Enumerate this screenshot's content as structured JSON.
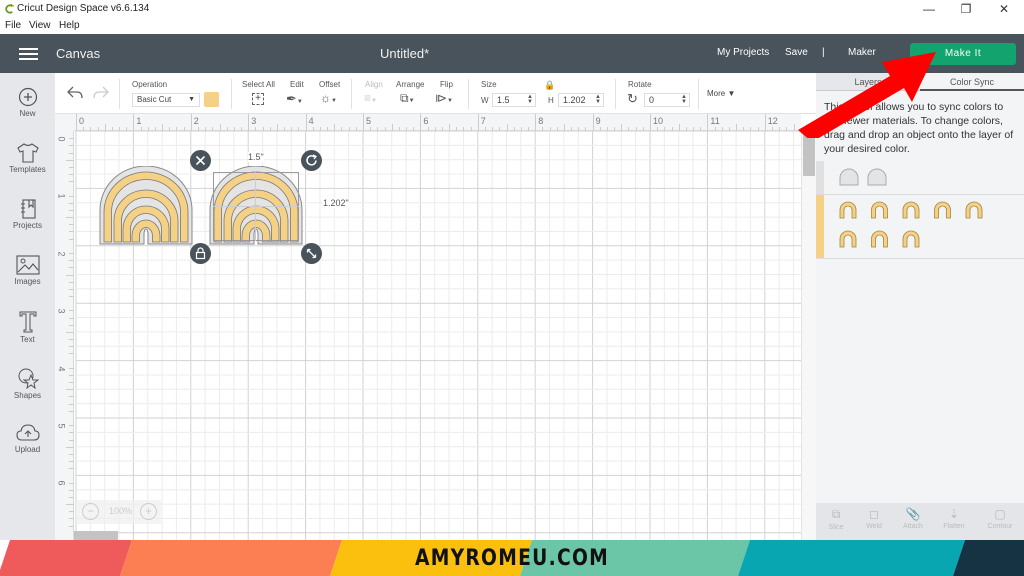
{
  "window": {
    "title": "Cricut Design Space  v6.6.134",
    "controls": [
      "minimize",
      "restore",
      "close"
    ]
  },
  "menubar": {
    "items": [
      "File",
      "View",
      "Help"
    ]
  },
  "header": {
    "section": "Canvas",
    "document_title": "Untitled*",
    "links": {
      "my_projects": "My Projects",
      "save": "Save",
      "separator": "|",
      "machine": "Maker"
    },
    "make_it": "Make It",
    "accent": "#12a36f"
  },
  "toolbar": {
    "operation_label": "Operation",
    "operation_value": "Basic Cut",
    "operation_color": "#f5d185",
    "select_all": "Select All",
    "edit": "Edit",
    "offset": "Offset",
    "align": "Align",
    "arrange": "Arrange",
    "flip": "Flip",
    "size_label": "Size",
    "w_label": "W",
    "w_value": "1.5",
    "h_label": "H",
    "h_value": "1.202",
    "rotate_label": "Rotate",
    "rotate_value": "0",
    "more": "More"
  },
  "sidebar": {
    "items": [
      {
        "label": "New",
        "icon": "plus-circle-icon"
      },
      {
        "label": "Templates",
        "icon": "tshirt-icon"
      },
      {
        "label": "Projects",
        "icon": "notebook-icon"
      },
      {
        "label": "Images",
        "icon": "image-icon"
      },
      {
        "label": "Text",
        "icon": "text-icon"
      },
      {
        "label": "Shapes",
        "icon": "shapes-icon"
      },
      {
        "label": "Upload",
        "icon": "cloud-upload-icon"
      }
    ]
  },
  "canvas": {
    "ruler_top": [
      "0",
      "1",
      "2",
      "3",
      "4",
      "5",
      "6",
      "7",
      "8",
      "9",
      "10",
      "11",
      "12"
    ],
    "ruler_left": [
      "0",
      "1",
      "2",
      "3",
      "4",
      "5",
      "6"
    ],
    "selection": {
      "width_label": "1.5\"",
      "height_label": "1.202\""
    },
    "zoom": "100%",
    "design_color": "#f5d185"
  },
  "panel": {
    "tabs": [
      "Layers",
      "Color Sync"
    ],
    "active_tab": "Color Sync",
    "description": "This panel allows you to sync colors to use fewer materials. To change colors, drag and drop an object onto the layer of your desired color.",
    "groups": [
      {
        "color": "#e0e0e0",
        "count": 2
      },
      {
        "color": "#f5d185",
        "count": 8
      }
    ],
    "actions": [
      "Slice",
      "Weld",
      "Attach",
      "Flatten",
      "Contour"
    ]
  },
  "footer": {
    "brand": "AMYROMEU.COM",
    "stripes": [
      "#ef5b5b",
      "#fc7f54",
      "#fbbf0d",
      "#6ac6a7",
      "#08a6b0",
      "#163344"
    ]
  }
}
